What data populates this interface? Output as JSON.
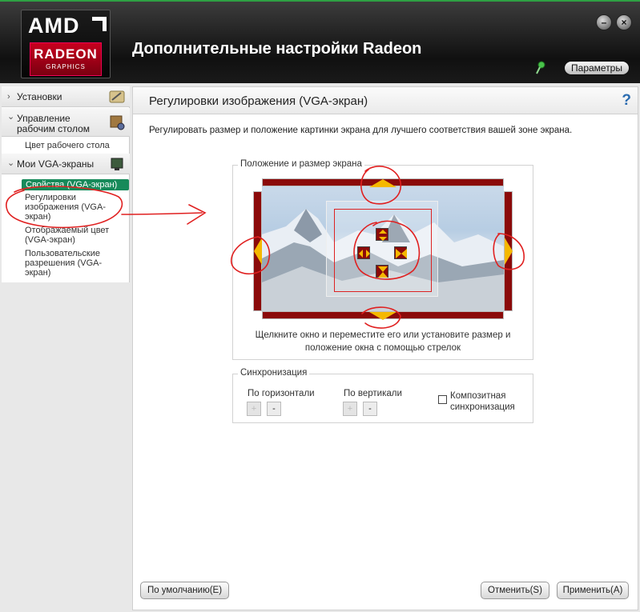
{
  "window": {
    "title": "Дополнительные настройки Radeon",
    "settings_label": "Параметры",
    "minimize_glyph": "–",
    "close_glyph": "×"
  },
  "logo": {
    "brand": "AMD",
    "product": "RADEON",
    "sub": "GRAPHICS"
  },
  "sidebar": {
    "groups": [
      {
        "chevron": "›",
        "label": "Установки",
        "icon": "preferences-icon"
      },
      {
        "chevron": "⌄",
        "label": "Управление рабочим столом",
        "icon": "desktop-management-icon"
      },
      {
        "chevron": "⌄",
        "label": "Мои VGA-экраны",
        "icon": "vga-display-icon"
      }
    ],
    "desktop_items": [
      "Цвет рабочего стола"
    ],
    "vga_items": [
      "Свойства (VGA-экран)",
      "Регулировки изображения (VGA-экран)",
      "Отображаемый цвет (VGA-экран)",
      "Пользовательские разрешения (VGA-экран)"
    ]
  },
  "main": {
    "title": "Регулировки изображения (VGA-экран)",
    "help": "?",
    "description": "Регулировать размер и положение картинки экрана для лучшего соответствия вашей зоне экрана.",
    "position_group": {
      "legend": "Положение и размер экрана",
      "hint_line1": "Щелкните окно и переместите его или установите размер и",
      "hint_line2": "положение окна с помощью стрелок"
    },
    "sync_group": {
      "legend": "Синхронизация",
      "horizontal_label": "По горизонтали",
      "vertical_label": "По вертикали",
      "plus": "+",
      "minus": "-",
      "composite_label_line1": "Композитная",
      "composite_label_line2": "синхронизация",
      "composite_checked": false
    }
  },
  "footer": {
    "default_label": "По умолчанию(E)",
    "cancel_label": "Отменить(S)",
    "apply_label": "Применить(A)"
  },
  "colors": {
    "accent_green": "#178a5a",
    "control_dark_red": "#8b0a0a",
    "annotation_red": "#e02020",
    "arrow_yellow": "#f5b800"
  }
}
